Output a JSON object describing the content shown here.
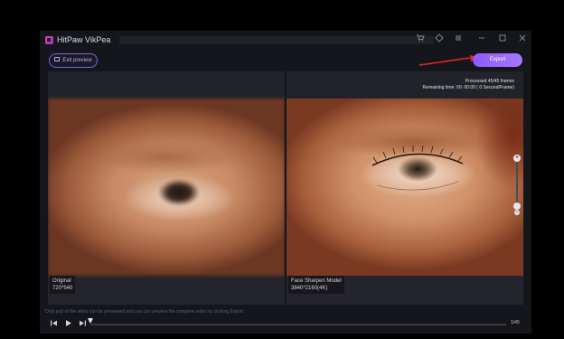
{
  "window": {
    "app_title": "HitPaw VikPea",
    "titlebar_icons": [
      "cart-icon",
      "diamond-icon",
      "menu-icon",
      "minimize-icon",
      "maximize-icon",
      "close-icon"
    ]
  },
  "toolbar": {
    "exit_preview_label": "Exit preview",
    "export_label": "Export"
  },
  "preview": {
    "left": {
      "label": "Original",
      "resolution": "720*540"
    },
    "right": {
      "model": "Face Sharpen Model",
      "resolution": "3840*2160(4K)",
      "processed": "Processed 45/45 frames",
      "remaining": "Remaining time: 00: 00:00 ( 0 Second/Frame)"
    }
  },
  "player": {
    "notice": "Only part of the video can be previewed and you can preview the complete video by clicking Export.",
    "frame_counter": "1/45",
    "progress": 0.0
  },
  "colors": {
    "accent": "#8c5cff",
    "arrow": "#e02626",
    "background": "#15161c"
  }
}
